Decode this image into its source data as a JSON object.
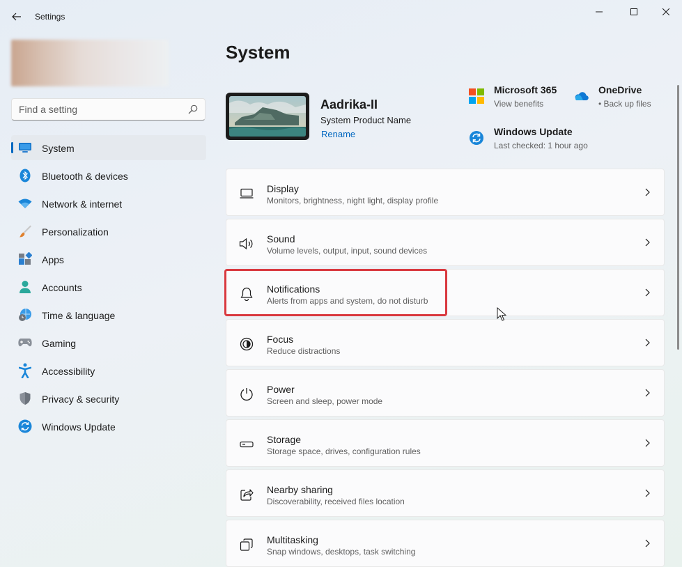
{
  "window": {
    "app_title": "Settings",
    "back_icon": "back-arrow-icon",
    "controls": [
      "minimize-icon",
      "maximize-icon",
      "close-icon"
    ]
  },
  "search": {
    "placeholder": "Find a setting",
    "icon": "search-icon"
  },
  "sidebar": {
    "items": [
      {
        "label": "System",
        "icon": "system-monitor-icon",
        "active": true
      },
      {
        "label": "Bluetooth & devices",
        "icon": "bluetooth-icon"
      },
      {
        "label": "Network & internet",
        "icon": "wifi-icon"
      },
      {
        "label": "Personalization",
        "icon": "paintbrush-icon"
      },
      {
        "label": "Apps",
        "icon": "apps-icon"
      },
      {
        "label": "Accounts",
        "icon": "person-icon"
      },
      {
        "label": "Time & language",
        "icon": "globe-clock-icon"
      },
      {
        "label": "Gaming",
        "icon": "gamepad-icon"
      },
      {
        "label": "Accessibility",
        "icon": "accessibility-icon"
      },
      {
        "label": "Privacy & security",
        "icon": "shield-icon"
      },
      {
        "label": "Windows Update",
        "icon": "update-icon"
      }
    ]
  },
  "main": {
    "title": "System",
    "device": {
      "name": "Aadrika-II",
      "model": "System Product Name",
      "rename_label": "Rename"
    },
    "quick_links": [
      {
        "title": "Microsoft 365",
        "subtitle": "View benefits",
        "icon": "microsoft-logo-icon"
      },
      {
        "title": "OneDrive",
        "subtitle": "• Back up files",
        "icon": "onedrive-cloud-icon"
      },
      {
        "title": "Windows Update",
        "subtitle": "Last checked: 1 hour ago",
        "icon": "windows-update-icon"
      }
    ],
    "cards": [
      {
        "title": "Display",
        "subtitle": "Monitors, brightness, night light, display profile",
        "icon": "display-icon"
      },
      {
        "title": "Sound",
        "subtitle": "Volume levels, output, input, sound devices",
        "icon": "speaker-icon"
      },
      {
        "title": "Notifications",
        "subtitle": "Alerts from apps and system, do not disturb",
        "icon": "bell-icon",
        "highlighted": true
      },
      {
        "title": "Focus",
        "subtitle": "Reduce distractions",
        "icon": "focus-icon"
      },
      {
        "title": "Power",
        "subtitle": "Screen and sleep, power mode",
        "icon": "power-icon"
      },
      {
        "title": "Storage",
        "subtitle": "Storage space, drives, configuration rules",
        "icon": "storage-drive-icon"
      },
      {
        "title": "Nearby sharing",
        "subtitle": "Discoverability, received files location",
        "icon": "share-icon"
      },
      {
        "title": "Multitasking",
        "subtitle": "Snap windows, desktops, task switching",
        "icon": "multitasking-icon"
      }
    ]
  },
  "colors": {
    "accent": "#0067c0",
    "highlight_border": "#d9393f"
  }
}
